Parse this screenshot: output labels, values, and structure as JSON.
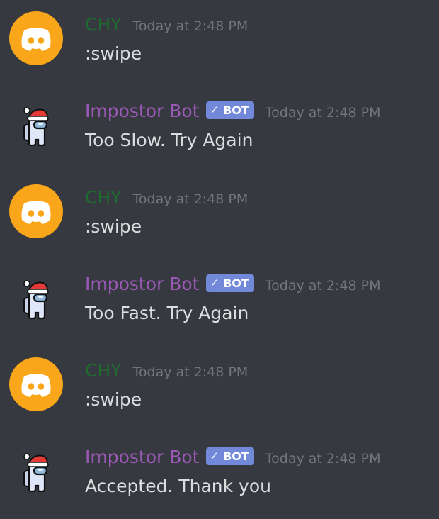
{
  "messages": [
    {
      "author": "CHY",
      "type": "user",
      "timestamp": "Today at 2:48 PM",
      "text": ":swipe"
    },
    {
      "author": "Impostor Bot",
      "type": "bot",
      "badge": "BOT",
      "timestamp": "Today at 2:48 PM",
      "text": "Too Slow. Try Again"
    },
    {
      "author": "CHY",
      "type": "user",
      "timestamp": "Today at 2:48 PM",
      "text": ":swipe"
    },
    {
      "author": "Impostor Bot",
      "type": "bot",
      "badge": "BOT",
      "timestamp": "Today at 2:48 PM",
      "text": "Too Fast. Try Again"
    },
    {
      "author": "CHY",
      "type": "user",
      "timestamp": "Today at 2:48 PM",
      "text": ":swipe"
    },
    {
      "author": "Impostor Bot",
      "type": "bot",
      "badge": "BOT",
      "timestamp": "Today at 2:48 PM",
      "text": "Accepted. Thank you"
    }
  ],
  "colors": {
    "background": "#36393f",
    "user_name": "#1f6b2e",
    "bot_name": "#9b59b6",
    "bot_badge": "#7289da",
    "timestamp": "#72767d",
    "message_text": "#dcddde",
    "discord_avatar": "#faa61a"
  },
  "icons": {
    "user_avatar": "discord-logo-icon",
    "bot_avatar": "crewmate-santa-hat-icon",
    "verified": "checkmark-icon"
  }
}
